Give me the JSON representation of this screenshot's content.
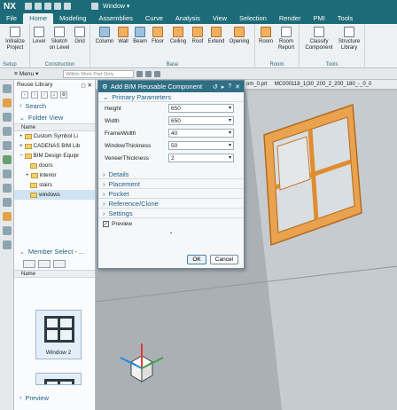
{
  "app": {
    "logo": "NX",
    "window_menu": "Window"
  },
  "menubar": {
    "tabs": [
      "File",
      "Home",
      "Modeling",
      "Assemblies",
      "Curve",
      "Analysis",
      "View",
      "Selection",
      "Render",
      "PMI",
      "Tools"
    ],
    "active_tab": "Home"
  },
  "ribbon": {
    "setup": {
      "label": "Setup",
      "buttons": [
        "Initialize Project"
      ]
    },
    "construction": {
      "label": "Construction",
      "buttons": [
        "Level",
        "Sketch on Level",
        "Grid"
      ]
    },
    "base": {
      "label": "Base",
      "buttons": [
        "Column",
        "Wall",
        "Beam",
        "Floor",
        "Ceiling",
        "Roof",
        "Extend",
        "Opening"
      ]
    },
    "room": {
      "label": "Room",
      "buttons": [
        "Room",
        "Room Report"
      ]
    },
    "tools": {
      "label": "Tools",
      "buttons": [
        "Classify Component",
        "Structure Library"
      ]
    }
  },
  "toolbar2": {
    "menu_label": "Menu",
    "filter_placeholder": "Within Work Part Only"
  },
  "library": {
    "title": "Reuse Library",
    "search_label": "Search",
    "folder_view_label": "Folder View",
    "name_header": "Name",
    "tree": [
      {
        "label": "Custom Symbol Li",
        "indent": 1
      },
      {
        "label": "CADENAS BIM Lib",
        "indent": 1
      },
      {
        "label": "BIM Design Equipr",
        "indent": 1
      },
      {
        "label": "doors",
        "indent": 2
      },
      {
        "label": "interior",
        "indent": 2
      },
      {
        "label": "stairs",
        "indent": 2
      },
      {
        "label": "windows",
        "indent": 2,
        "selected": true
      }
    ],
    "member_select_label": "Member Select - ...",
    "member_name_header": "Name",
    "member_item": "Window 2",
    "preview_label": "Preview"
  },
  "viewport": {
    "tab1": "om_0.prt",
    "tab2": "MC000118_1(30_200_2_200_180_-_0_0"
  },
  "dialog": {
    "title": "Add BIM Reusable Component",
    "primary_params_label": "Primary Parameters",
    "params": [
      {
        "label": "Height",
        "value": "650"
      },
      {
        "label": "Width",
        "value": "650"
      },
      {
        "label": "FrameWidth",
        "value": "40"
      },
      {
        "label": "WindowThickness",
        "value": "50"
      },
      {
        "label": "VeneerThickness",
        "value": "2"
      }
    ],
    "sections": [
      "Details",
      "Placement",
      "Pocket",
      "Reference/Clone",
      "Settings"
    ],
    "preview_label": "Preview",
    "preview_checked": true,
    "ok_label": "OK",
    "cancel_label": "Cancel"
  }
}
